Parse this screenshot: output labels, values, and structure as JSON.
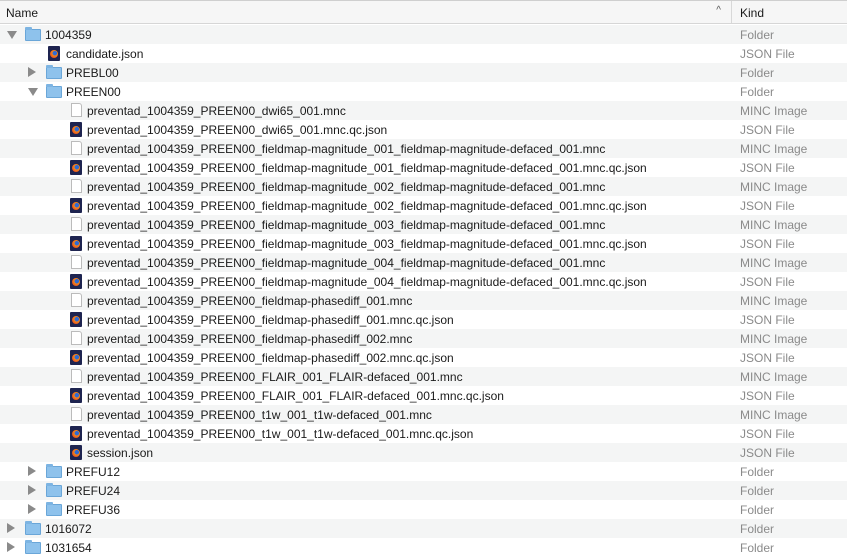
{
  "header": {
    "name_label": "Name",
    "kind_label": "Kind",
    "sort_indicator": "^"
  },
  "rows": [
    {
      "name": "1004359",
      "kind": "Folder",
      "level": 0,
      "type": "folder",
      "expanded": true
    },
    {
      "name": "candidate.json",
      "kind": "JSON File",
      "level": 1,
      "type": "json"
    },
    {
      "name": "PREBL00",
      "kind": "Folder",
      "level": 1,
      "type": "folder",
      "expanded": false
    },
    {
      "name": "PREEN00",
      "kind": "Folder",
      "level": 1,
      "type": "folder",
      "expanded": true
    },
    {
      "name": "preventad_1004359_PREEN00_dwi65_001.mnc",
      "kind": "MINC Image",
      "level": 2,
      "type": "doc"
    },
    {
      "name": "preventad_1004359_PREEN00_dwi65_001.mnc.qc.json",
      "kind": "JSON File",
      "level": 2,
      "type": "json"
    },
    {
      "name": "preventad_1004359_PREEN00_fieldmap-magnitude_001_fieldmap-magnitude-defaced_001.mnc",
      "kind": "MINC Image",
      "level": 2,
      "type": "doc"
    },
    {
      "name": "preventad_1004359_PREEN00_fieldmap-magnitude_001_fieldmap-magnitude-defaced_001.mnc.qc.json",
      "kind": "JSON File",
      "level": 2,
      "type": "json"
    },
    {
      "name": "preventad_1004359_PREEN00_fieldmap-magnitude_002_fieldmap-magnitude-defaced_001.mnc",
      "kind": "MINC Image",
      "level": 2,
      "type": "doc"
    },
    {
      "name": "preventad_1004359_PREEN00_fieldmap-magnitude_002_fieldmap-magnitude-defaced_001.mnc.qc.json",
      "kind": "JSON File",
      "level": 2,
      "type": "json"
    },
    {
      "name": "preventad_1004359_PREEN00_fieldmap-magnitude_003_fieldmap-magnitude-defaced_001.mnc",
      "kind": "MINC Image",
      "level": 2,
      "type": "doc"
    },
    {
      "name": "preventad_1004359_PREEN00_fieldmap-magnitude_003_fieldmap-magnitude-defaced_001.mnc.qc.json",
      "kind": "JSON File",
      "level": 2,
      "type": "json"
    },
    {
      "name": "preventad_1004359_PREEN00_fieldmap-magnitude_004_fieldmap-magnitude-defaced_001.mnc",
      "kind": "MINC Image",
      "level": 2,
      "type": "doc"
    },
    {
      "name": "preventad_1004359_PREEN00_fieldmap-magnitude_004_fieldmap-magnitude-defaced_001.mnc.qc.json",
      "kind": "JSON File",
      "level": 2,
      "type": "json"
    },
    {
      "name": "preventad_1004359_PREEN00_fieldmap-phasediff_001.mnc",
      "kind": "MINC Image",
      "level": 2,
      "type": "doc"
    },
    {
      "name": "preventad_1004359_PREEN00_fieldmap-phasediff_001.mnc.qc.json",
      "kind": "JSON File",
      "level": 2,
      "type": "json"
    },
    {
      "name": "preventad_1004359_PREEN00_fieldmap-phasediff_002.mnc",
      "kind": "MINC Image",
      "level": 2,
      "type": "doc"
    },
    {
      "name": "preventad_1004359_PREEN00_fieldmap-phasediff_002.mnc.qc.json",
      "kind": "JSON File",
      "level": 2,
      "type": "json"
    },
    {
      "name": "preventad_1004359_PREEN00_FLAIR_001_FLAIR-defaced_001.mnc",
      "kind": "MINC Image",
      "level": 2,
      "type": "doc"
    },
    {
      "name": "preventad_1004359_PREEN00_FLAIR_001_FLAIR-defaced_001.mnc.qc.json",
      "kind": "JSON File",
      "level": 2,
      "type": "json"
    },
    {
      "name": "preventad_1004359_PREEN00_t1w_001_t1w-defaced_001.mnc",
      "kind": "MINC Image",
      "level": 2,
      "type": "doc"
    },
    {
      "name": "preventad_1004359_PREEN00_t1w_001_t1w-defaced_001.mnc.qc.json",
      "kind": "JSON File",
      "level": 2,
      "type": "json"
    },
    {
      "name": "session.json",
      "kind": "JSON File",
      "level": 2,
      "type": "json"
    },
    {
      "name": "PREFU12",
      "kind": "Folder",
      "level": 1,
      "type": "folder",
      "expanded": false
    },
    {
      "name": "PREFU24",
      "kind": "Folder",
      "level": 1,
      "type": "folder",
      "expanded": false
    },
    {
      "name": "PREFU36",
      "kind": "Folder",
      "level": 1,
      "type": "folder",
      "expanded": false
    },
    {
      "name": "1016072",
      "kind": "Folder",
      "level": 0,
      "type": "folder",
      "expanded": false
    },
    {
      "name": "1031654",
      "kind": "Folder",
      "level": 0,
      "type": "folder",
      "expanded": false
    }
  ],
  "icons": {
    "folder": "folder-icon",
    "json": "json-file-icon",
    "doc": "document-icon"
  }
}
